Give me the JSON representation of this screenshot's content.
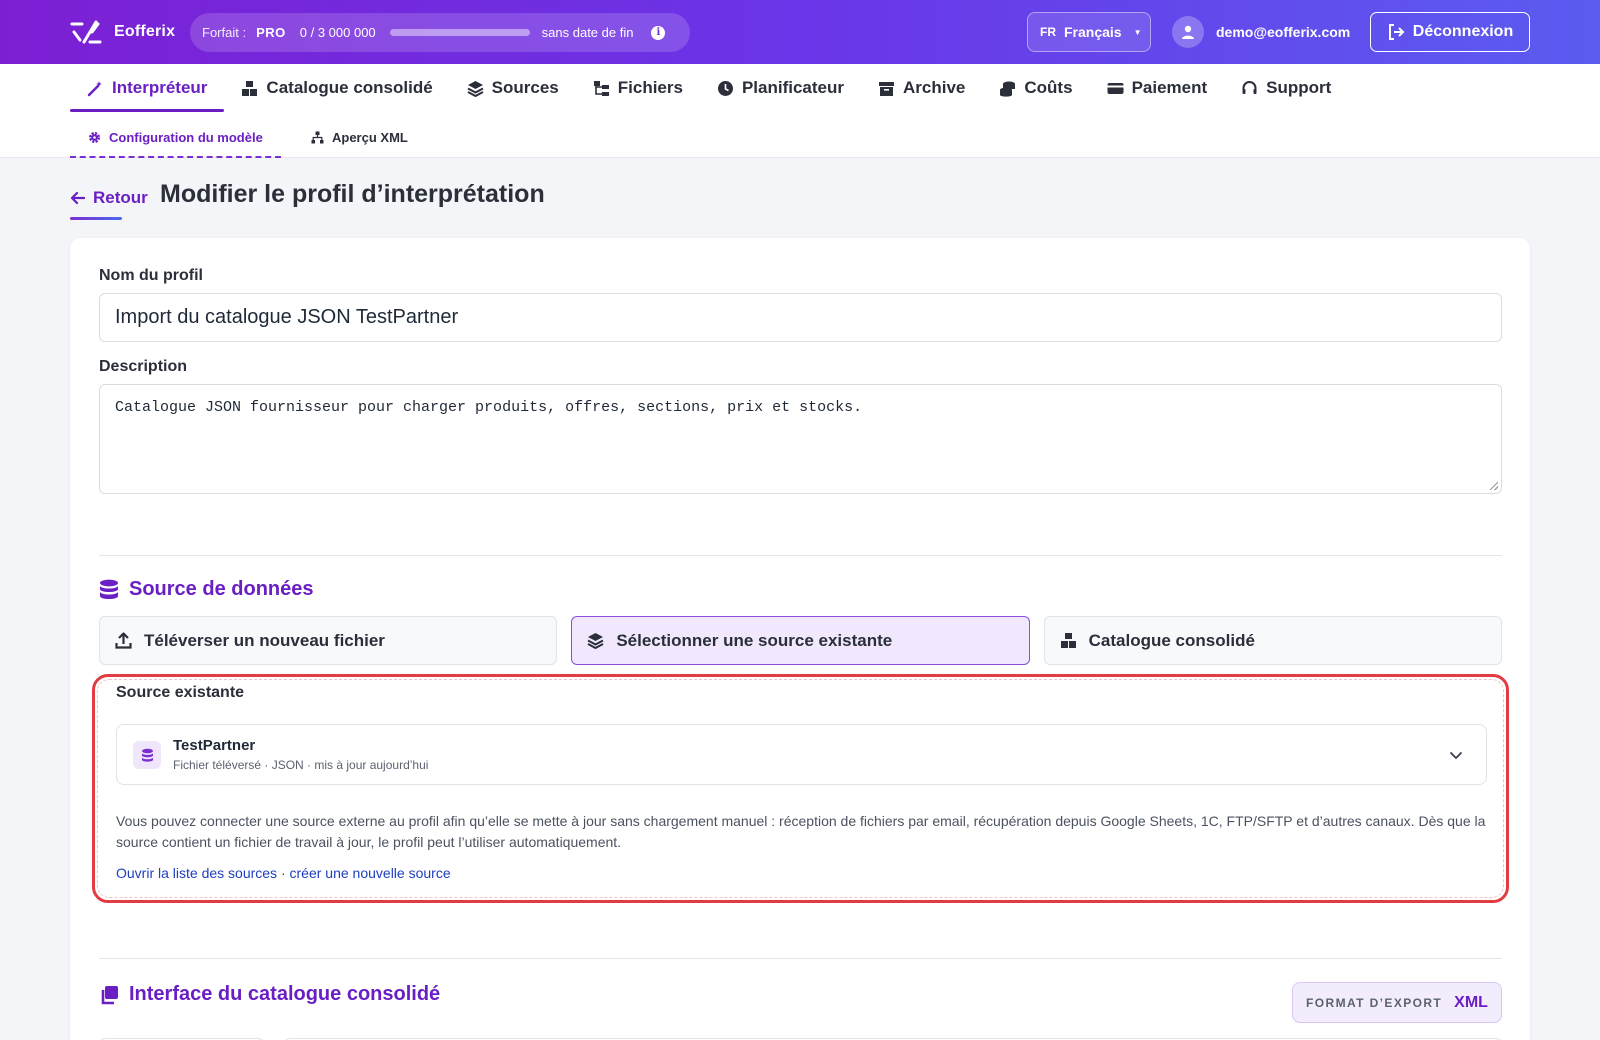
{
  "header": {
    "logo_text": "Eofferix",
    "plan_label": "Forfait :",
    "plan_name": "PRO",
    "usage_text": "0 / 3 000 000",
    "usage_fraction": 0,
    "expiry_text": "sans date de fin",
    "lang_code": "FR",
    "lang_name": "Français",
    "user_email": "demo@eofferix.com",
    "logout_label": "Déconnexion"
  },
  "nav": {
    "items": [
      {
        "label": "Interpréteur",
        "icon": "wand-icon",
        "active": true
      },
      {
        "label": "Catalogue consolidé",
        "icon": "boxes-icon"
      },
      {
        "label": "Sources",
        "icon": "layers-icon"
      },
      {
        "label": "Fichiers",
        "icon": "folder-tree-icon"
      },
      {
        "label": "Planificateur",
        "icon": "clock-icon"
      },
      {
        "label": "Archive",
        "icon": "archive-icon"
      },
      {
        "label": "Coûts",
        "icon": "coins-icon"
      },
      {
        "label": "Paiement",
        "icon": "credit-card-icon"
      },
      {
        "label": "Support",
        "icon": "headset-icon"
      }
    ],
    "subitems": [
      {
        "label": "Configuration du modèle",
        "icon": "gear-icon",
        "active": true
      },
      {
        "label": "Aperçu XML",
        "icon": "sitemap-icon"
      }
    ]
  },
  "page": {
    "back_label": "Retour",
    "title": "Modifier le profil d’interprétation"
  },
  "form": {
    "name_label": "Nom du profil",
    "name_value": "Import du catalogue JSON TestPartner",
    "description_label": "Description",
    "description_value": "Catalogue JSON fournisseur pour charger produits, offres, sections, prix et stocks."
  },
  "data_source": {
    "title": "Source de données",
    "tabs": [
      {
        "label": "Téléverser un nouveau fichier",
        "icon": "upload-icon"
      },
      {
        "label": "Sélectionner une source existante",
        "icon": "layers-icon",
        "active": true
      },
      {
        "label": "Catalogue consolidé",
        "icon": "boxes-icon"
      }
    ],
    "existing_label": "Source existante",
    "selected_name": "TestPartner",
    "selected_meta": "Fichier téléversé · JSON · mis à jour aujourd’hui",
    "help_text": "Vous pouvez connecter une source externe au profil afin qu’elle se mette à jour sans chargement manuel : réception de fichiers par email, récupération depuis Google Sheets, 1C, FTP/SFTP et d’autres canaux. Dès que la source contient un fichier de travail à jour, le profil peut l’utiliser automatiquement.",
    "link_list": "Ouvrir la liste des sources",
    "link_separator": " · ",
    "link_create": "créer une nouvelle source"
  },
  "catalog_interface": {
    "title": "Interface du catalogue consolidé",
    "export_label": "FORMAT D’EXPORT",
    "export_value": "XML"
  },
  "colors": {
    "accent": "#6a1fc4",
    "highlight": "#e33b42",
    "link": "#1d3fbf"
  }
}
